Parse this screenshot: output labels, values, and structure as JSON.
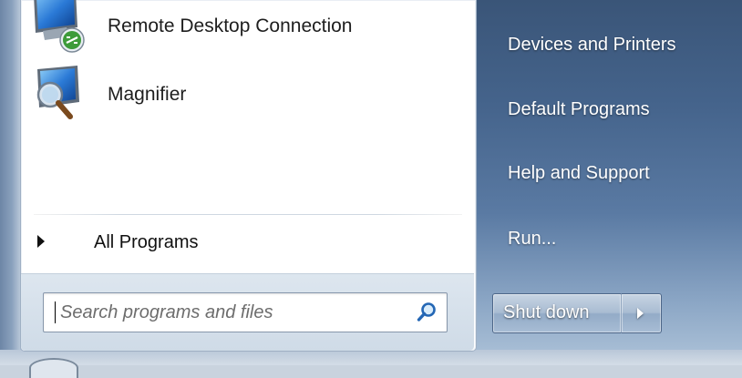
{
  "start_menu": {
    "pinned": [
      {
        "label": "Remote Desktop Connection",
        "icon": "remote-desktop-icon"
      },
      {
        "label": "Magnifier",
        "icon": "magnifier-icon"
      }
    ],
    "all_programs_label": "All Programs",
    "search": {
      "placeholder": "Search programs and files",
      "icon": "search-icon"
    },
    "right_links": [
      {
        "label": "Devices and Printers"
      },
      {
        "label": "Default Programs"
      },
      {
        "label": "Help and Support"
      },
      {
        "label": "Run..."
      }
    ],
    "shutdown": {
      "label": "Shut down",
      "arrow_icon": "chevron-right-icon"
    }
  },
  "colors": {
    "right_pane": "#45648c",
    "left_pane": "#ffffff",
    "search_area": "#d6e0ea",
    "link_text": "#ffffff",
    "item_text": "#1e1e1e"
  }
}
